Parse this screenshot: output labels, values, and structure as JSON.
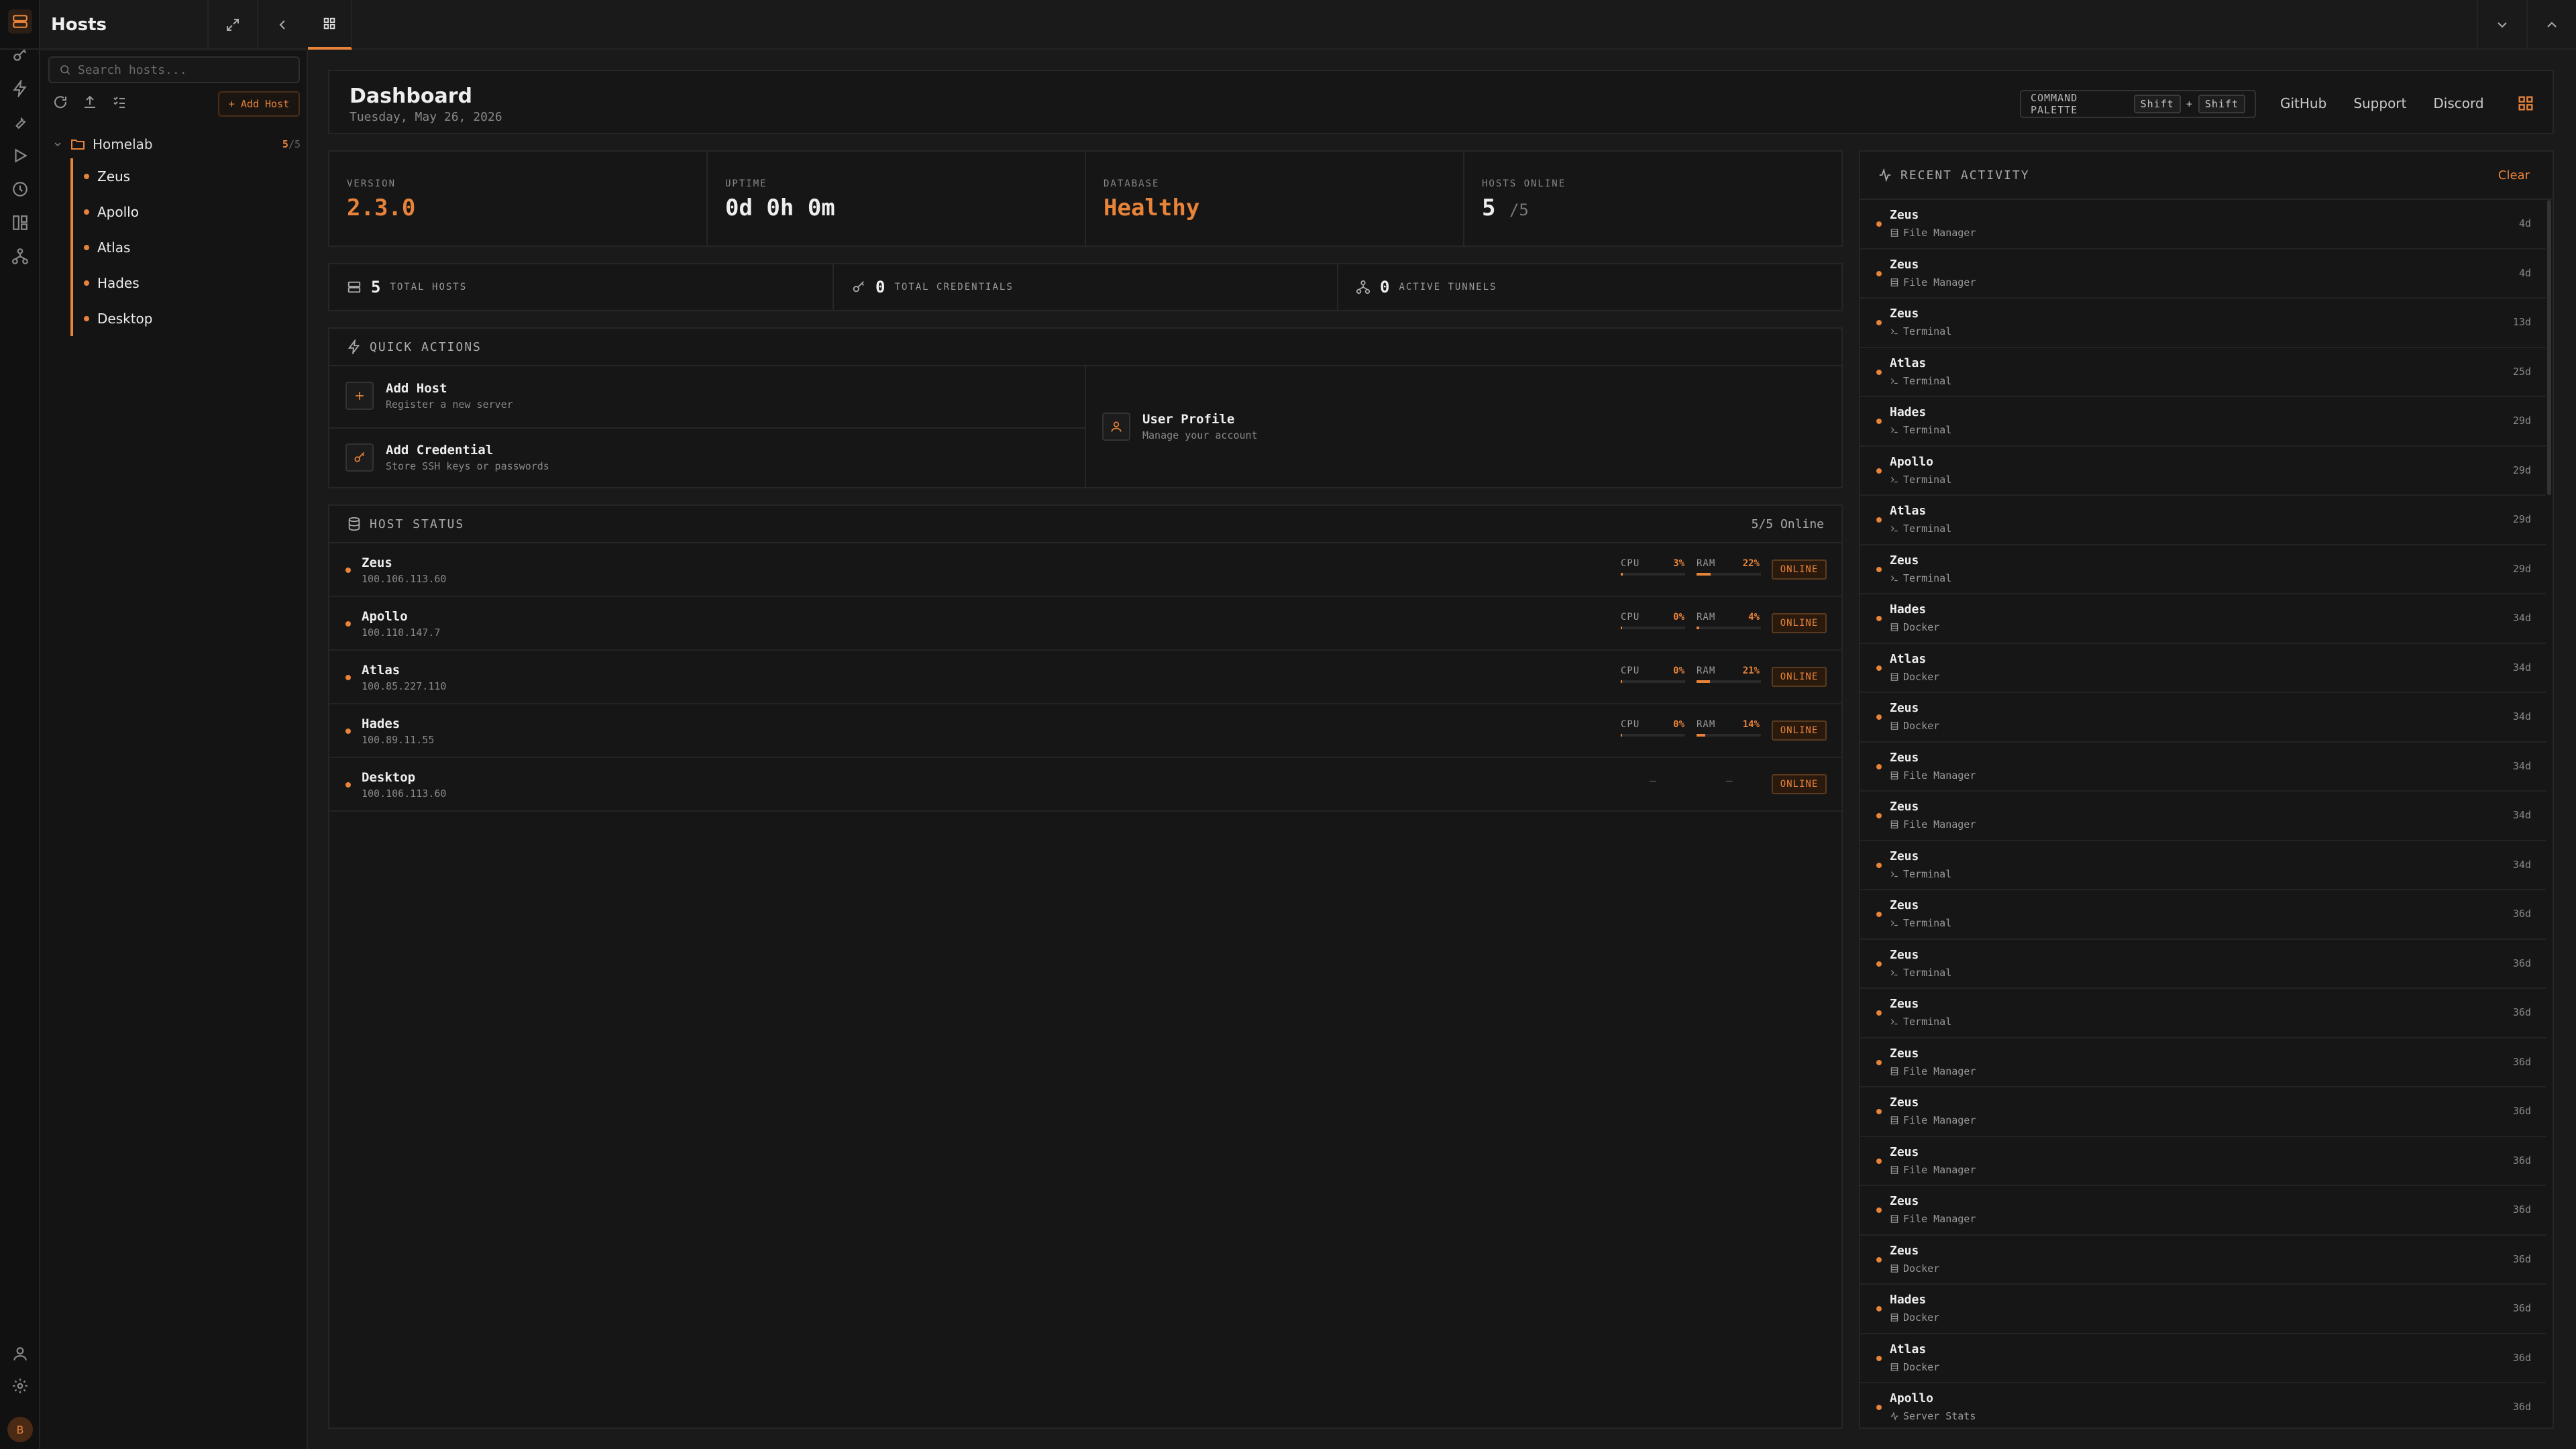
{
  "sidebar": {
    "title": "Hosts",
    "search_placeholder": "Search hosts...",
    "add_host_label": "+ Add Host",
    "folder": {
      "name": "Homelab",
      "online": "5",
      "total": "/5"
    },
    "hosts": [
      "Zeus",
      "Apollo",
      "Atlas",
      "Hades",
      "Desktop"
    ],
    "avatar_initial": "B"
  },
  "header": {
    "title": "Dashboard",
    "date": "Tuesday, May 26, 2026",
    "command_palette": "COMMAND PALETTE",
    "key1": "Shift",
    "plus": "+",
    "key2": "Shift",
    "links": [
      "GitHub",
      "Support",
      "Discord"
    ]
  },
  "stats": {
    "version": {
      "label": "VERSION",
      "value": "2.3.0"
    },
    "uptime": {
      "label": "UPTIME",
      "value": "0d 0h 0m"
    },
    "database": {
      "label": "DATABASE",
      "value": "Healthy"
    },
    "hosts_online": {
      "label": "HOSTS ONLINE",
      "value": "5",
      "total": "/5"
    }
  },
  "counts": {
    "hosts": {
      "num": "5",
      "label": "TOTAL HOSTS"
    },
    "credentials": {
      "num": "0",
      "label": "TOTAL CREDENTIALS"
    },
    "tunnels": {
      "num": "0",
      "label": "ACTIVE TUNNELS"
    }
  },
  "quick_actions": {
    "title": "QUICK ACTIONS",
    "add_host": {
      "title": "Add Host",
      "sub": "Register a new server"
    },
    "add_credential": {
      "title": "Add Credential",
      "sub": "Store SSH keys or passwords"
    },
    "user_profile": {
      "title": "User Profile",
      "sub": "Manage your account"
    }
  },
  "host_status": {
    "title": "HOST STATUS",
    "summary": "5/5 Online",
    "cpu_label": "CPU",
    "ram_label": "RAM",
    "rows": [
      {
        "name": "Zeus",
        "ip": "100.106.113.60",
        "cpu": "3%",
        "ram": "22%",
        "cpu_frac": 0.03,
        "ram_frac": 0.22,
        "status": "ONLINE"
      },
      {
        "name": "Apollo",
        "ip": "100.110.147.7",
        "cpu": "0%",
        "ram": "4%",
        "cpu_frac": 0.0,
        "ram_frac": 0.04,
        "status": "ONLINE"
      },
      {
        "name": "Atlas",
        "ip": "100.85.227.110",
        "cpu": "0%",
        "ram": "21%",
        "cpu_frac": 0.0,
        "ram_frac": 0.21,
        "status": "ONLINE"
      },
      {
        "name": "Hades",
        "ip": "100.89.11.55",
        "cpu": "0%",
        "ram": "14%",
        "cpu_frac": 0.0,
        "ram_frac": 0.14,
        "status": "ONLINE"
      },
      {
        "name": "Desktop",
        "ip": "100.106.113.60",
        "cpu": "—",
        "ram": "—",
        "status": "ONLINE"
      }
    ]
  },
  "recent_activity": {
    "title": "RECENT ACTIVITY",
    "clear": "Clear",
    "items": [
      {
        "host": "Zeus",
        "type": "File Manager",
        "time": "4d"
      },
      {
        "host": "Zeus",
        "type": "File Manager",
        "time": "4d"
      },
      {
        "host": "Zeus",
        "type": "Terminal",
        "time": "13d"
      },
      {
        "host": "Atlas",
        "type": "Terminal",
        "time": "25d"
      },
      {
        "host": "Hades",
        "type": "Terminal",
        "time": "29d"
      },
      {
        "host": "Apollo",
        "type": "Terminal",
        "time": "29d"
      },
      {
        "host": "Atlas",
        "type": "Terminal",
        "time": "29d"
      },
      {
        "host": "Zeus",
        "type": "Terminal",
        "time": "29d"
      },
      {
        "host": "Hades",
        "type": "Docker",
        "time": "34d"
      },
      {
        "host": "Atlas",
        "type": "Docker",
        "time": "34d"
      },
      {
        "host": "Zeus",
        "type": "Docker",
        "time": "34d"
      },
      {
        "host": "Zeus",
        "type": "File Manager",
        "time": "34d"
      },
      {
        "host": "Zeus",
        "type": "File Manager",
        "time": "34d"
      },
      {
        "host": "Zeus",
        "type": "Terminal",
        "time": "34d"
      },
      {
        "host": "Zeus",
        "type": "Terminal",
        "time": "36d"
      },
      {
        "host": "Zeus",
        "type": "Terminal",
        "time": "36d"
      },
      {
        "host": "Zeus",
        "type": "Terminal",
        "time": "36d"
      },
      {
        "host": "Zeus",
        "type": "File Manager",
        "time": "36d"
      },
      {
        "host": "Zeus",
        "type": "File Manager",
        "time": "36d"
      },
      {
        "host": "Zeus",
        "type": "File Manager",
        "time": "36d"
      },
      {
        "host": "Zeus",
        "type": "File Manager",
        "time": "36d"
      },
      {
        "host": "Zeus",
        "type": "Docker",
        "time": "36d"
      },
      {
        "host": "Hades",
        "type": "Docker",
        "time": "36d"
      },
      {
        "host": "Atlas",
        "type": "Docker",
        "time": "36d"
      },
      {
        "host": "Apollo",
        "type": "Server Stats",
        "time": "36d"
      }
    ]
  },
  "colors": {
    "accent": "#e8833a",
    "background": "#1a1a1a",
    "panel": "#161616"
  }
}
